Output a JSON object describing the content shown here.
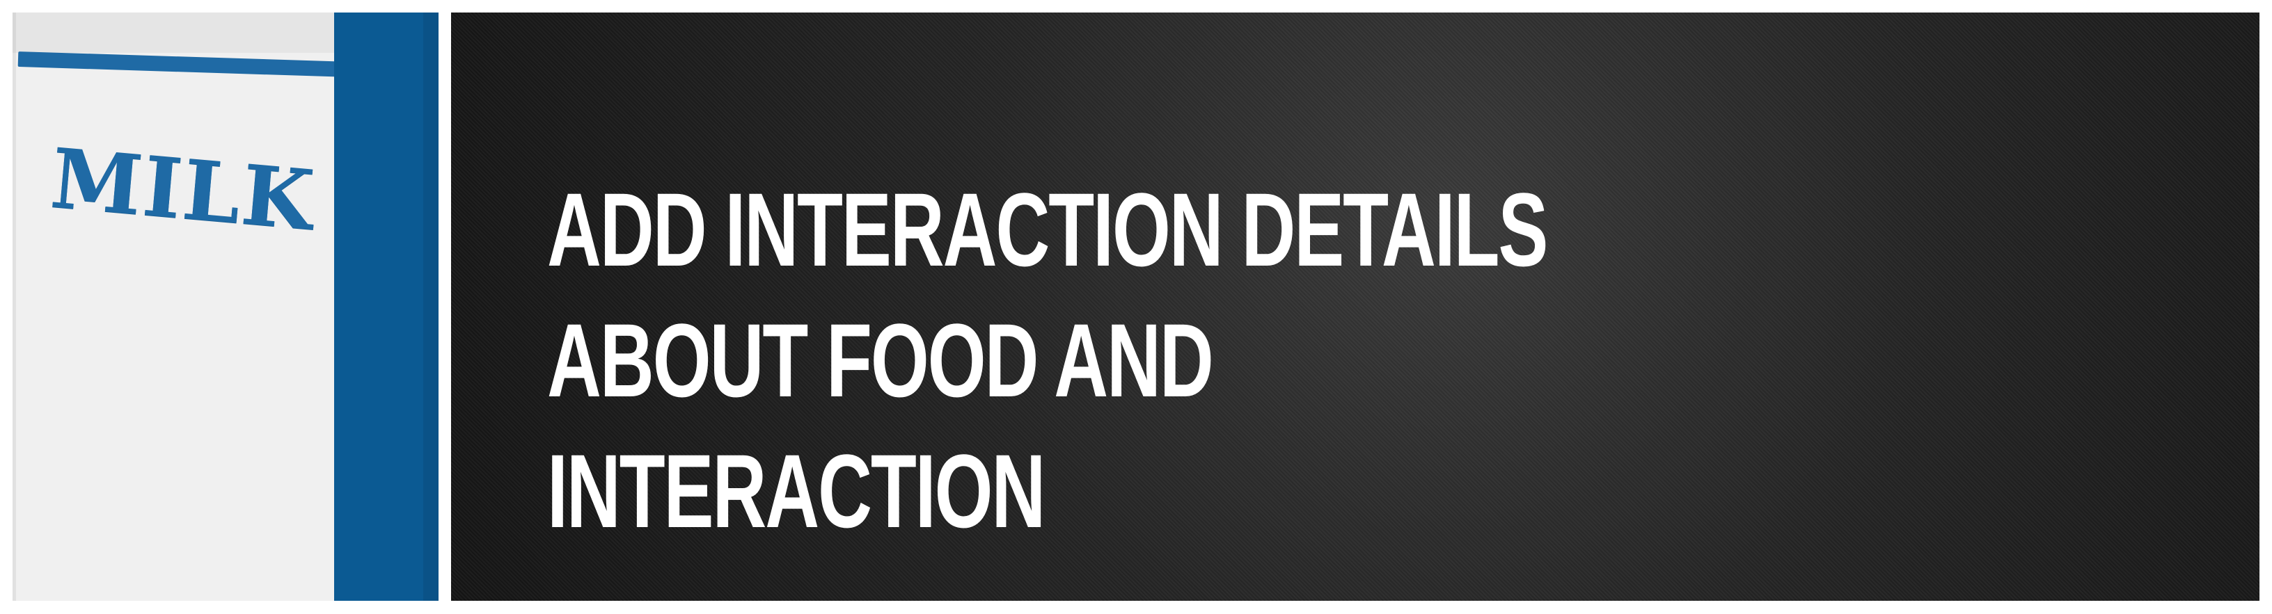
{
  "product_panel": {
    "label": "MILK",
    "colors": {
      "carton_face": "#f0f0f0",
      "carton_side": "#0b5a93",
      "label_blue": "#1f6aa5"
    }
  },
  "banner": {
    "title": "ADD INTERACTION DETAILS ABOUT FOOD AND INTERACTION",
    "colors": {
      "background": "#1f1f1f",
      "text": "#ffffff"
    }
  }
}
